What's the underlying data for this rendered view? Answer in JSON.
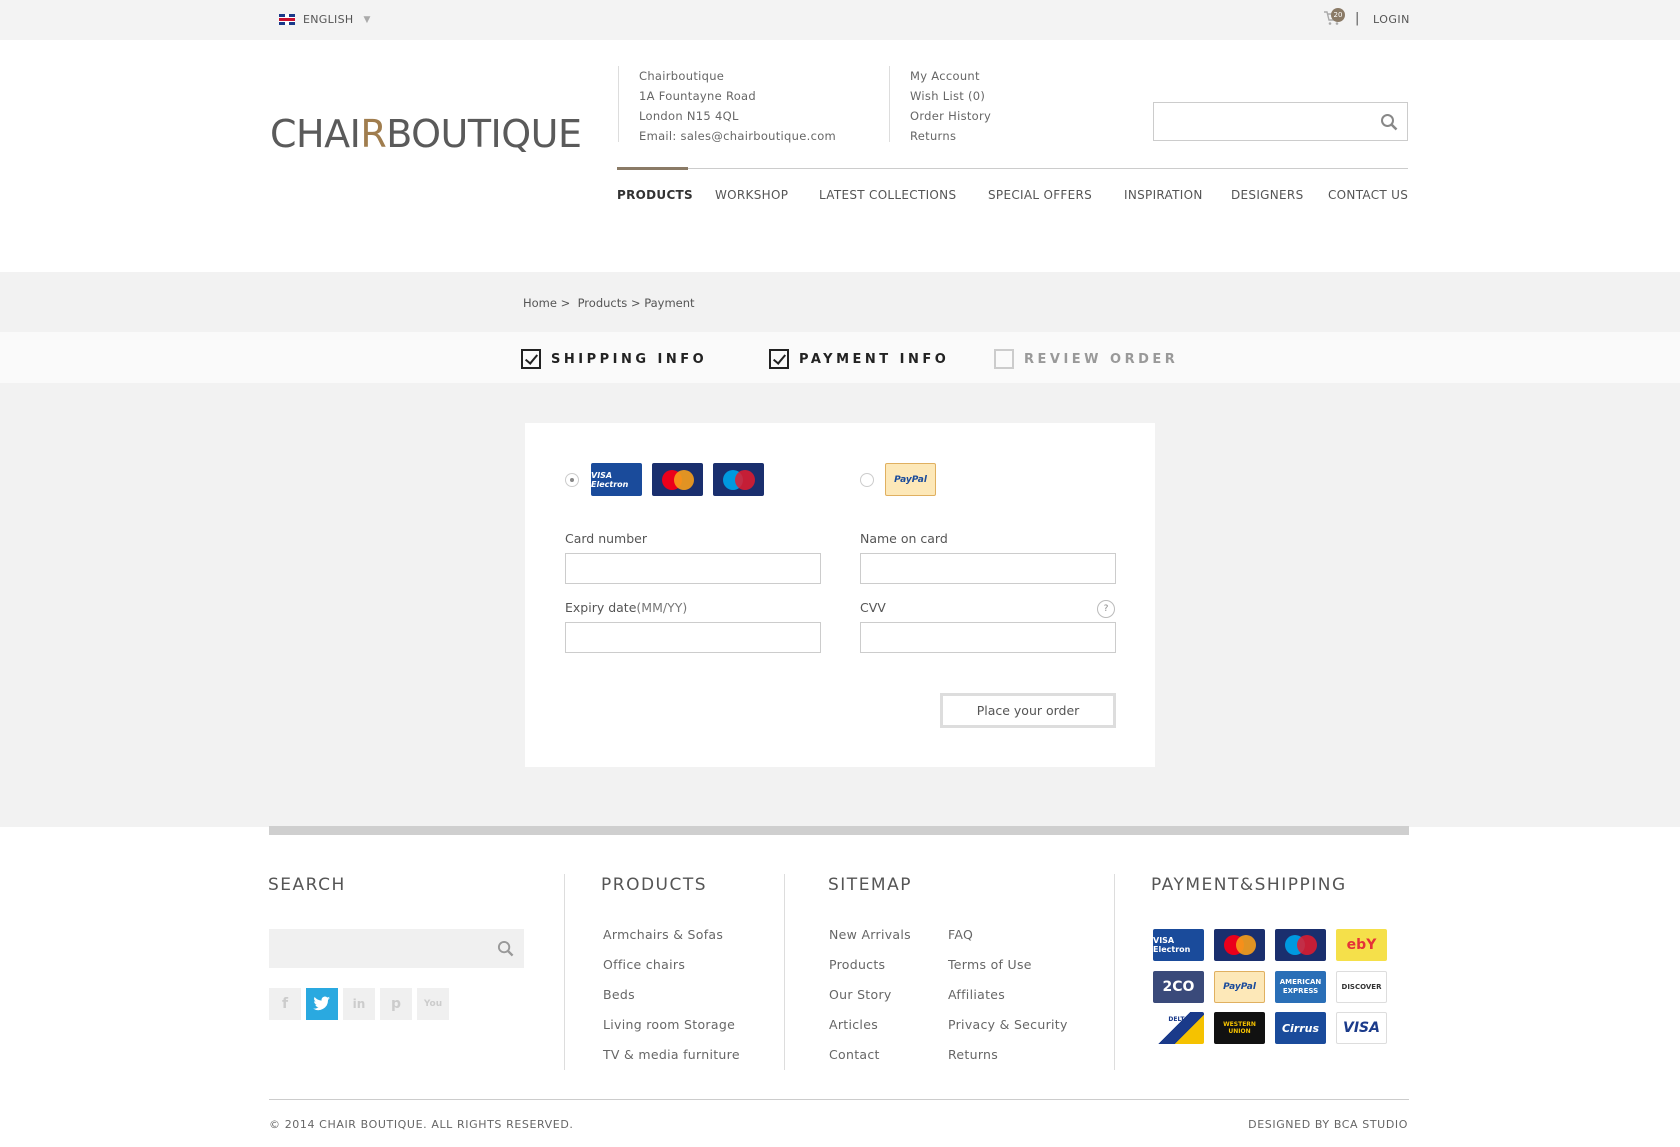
{
  "topbar": {
    "language": "ENGLISH",
    "cart_count": "20",
    "separator": "|",
    "login": "LOGIN"
  },
  "header": {
    "logo_part1": "CHAI",
    "logo_r": "R",
    "logo_part2": "BOUTIQUE",
    "address": [
      "Chairboutique",
      "1A Fountayne Road",
      "London N15 4QL",
      "Email: sales@chairboutique.com"
    ],
    "account_links": [
      "My Account",
      "Wish List (0)",
      "Order History",
      "Returns"
    ],
    "search_placeholder": ""
  },
  "nav": [
    "PRODUCTS",
    "WORKSHOP",
    "LATEST COLLECTIONS",
    "SPECIAL OFFERS",
    "INSPIRATION",
    "DESIGNERS",
    "CONTACT US"
  ],
  "breadcrumb": {
    "home": "Home",
    "products": "Products",
    "current": "Payment",
    "sep": ">"
  },
  "steps": [
    {
      "label": "SHIPPING INFO",
      "checked": true
    },
    {
      "label": "PAYMENT INFO",
      "checked": true
    },
    {
      "label": "REVIEW ORDER",
      "checked": false
    }
  ],
  "payment": {
    "methods_card": [
      "VISA Electron",
      "MasterCard",
      "Maestro"
    ],
    "method_paypal": "PayPal",
    "card_number_label": "Card number",
    "name_on_card_label": "Name on card",
    "expiry_label": "Expiry date",
    "expiry_hint": "(MM/YY)",
    "cvv_label": "CVV",
    "cvv_help": "?",
    "place_order": "Place your order"
  },
  "footer": {
    "search_title": "SEARCH",
    "products_title": "PRODUCTS",
    "sitemap_title": "SITEMAP",
    "payment_title": "PAYMENT&SHIPPING",
    "products_links": [
      "Armchairs & Sofas",
      "Office chairs",
      "Beds",
      "Living room Storage",
      "TV & media furniture"
    ],
    "sitemap_col1": [
      "New Arrivals",
      "Products",
      "Our Story",
      "Articles",
      "Contact"
    ],
    "sitemap_col2": [
      "FAQ",
      "Terms of Use",
      "Affiliates",
      "Privacy & Security",
      "Returns"
    ],
    "social": [
      "f",
      "t",
      "in",
      "p",
      "You"
    ],
    "payment_logos": [
      "VISA Electron",
      "MasterCard",
      "Maestro",
      "ebY",
      "2CO",
      "PayPal",
      "AMERICAN EXPRESS",
      "DISCOVER",
      "DELTA",
      "WESTERN UNION",
      "Cirrus",
      "VISA"
    ],
    "copyright": "© 2014 CHAIR BOUTIQUE. ALL RIGHTS RESERVED.",
    "designed_by": "DESIGNED BY BCA STUDIO"
  },
  "colors": {
    "accent": "#8a7a66",
    "logo_r": "#a07d4e",
    "twitter": "#2aa9e0"
  }
}
